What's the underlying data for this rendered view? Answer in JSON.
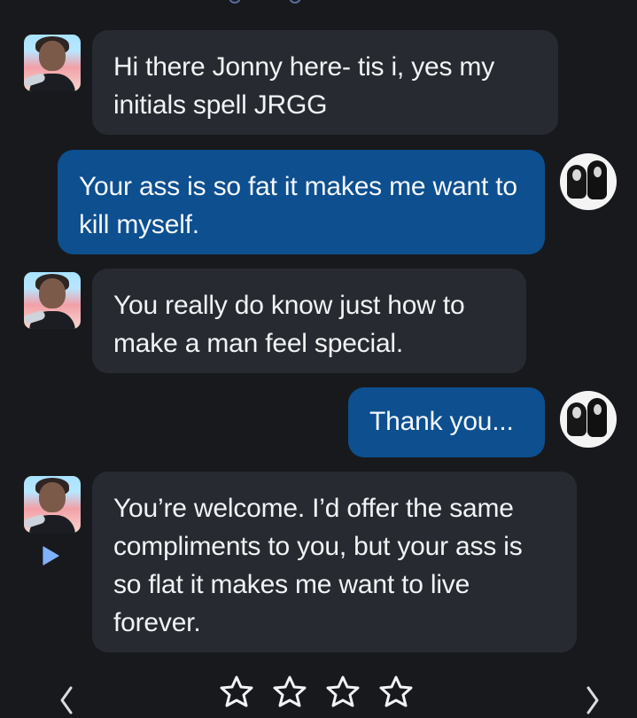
{
  "messages": [
    {
      "sender": "bot",
      "text": "Hi there Jonny here- tis i, yes my initials spell JRGG"
    },
    {
      "sender": "user",
      "text": "Your ass is so fat it makes me want to kill myself."
    },
    {
      "sender": "bot",
      "text": "You really do know just how to make a man feel special."
    },
    {
      "sender": "user",
      "text": "Thank you..."
    },
    {
      "sender": "bot",
      "text": "You’re welcome. I’d offer the same compliments to you, but your ass is so flat it makes me want to live forever."
    }
  ],
  "icons": {
    "play": "play-icon",
    "star": "star-outline-icon",
    "left_chevron": "chevron-left-icon",
    "right_chevron": "chevron-right-icon"
  },
  "rating": {
    "stars": 4,
    "value": 0
  },
  "colors": {
    "background": "#18191d",
    "bot_bubble": "#272b31",
    "user_bubble": "#0d4f8f",
    "accent": "#7fb1ff",
    "text": "#f1f3f5"
  }
}
